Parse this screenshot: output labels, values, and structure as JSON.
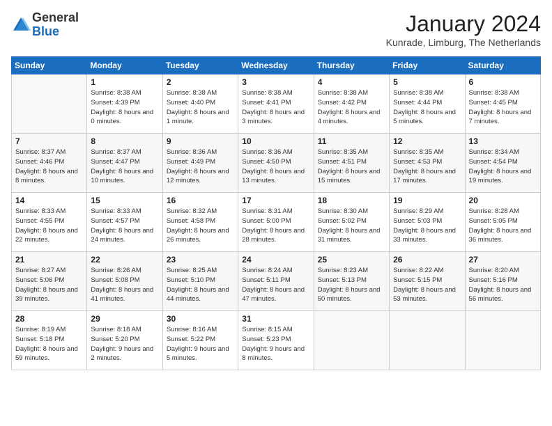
{
  "header": {
    "logo_general": "General",
    "logo_blue": "Blue",
    "month_title": "January 2024",
    "location": "Kunrade, Limburg, The Netherlands"
  },
  "days_of_week": [
    "Sunday",
    "Monday",
    "Tuesday",
    "Wednesday",
    "Thursday",
    "Friday",
    "Saturday"
  ],
  "weeks": [
    [
      {
        "day": "",
        "empty": true
      },
      {
        "day": "1",
        "sunrise": "Sunrise: 8:38 AM",
        "sunset": "Sunset: 4:39 PM",
        "daylight": "Daylight: 8 hours and 0 minutes."
      },
      {
        "day": "2",
        "sunrise": "Sunrise: 8:38 AM",
        "sunset": "Sunset: 4:40 PM",
        "daylight": "Daylight: 8 hours and 1 minute."
      },
      {
        "day": "3",
        "sunrise": "Sunrise: 8:38 AM",
        "sunset": "Sunset: 4:41 PM",
        "daylight": "Daylight: 8 hours and 3 minutes."
      },
      {
        "day": "4",
        "sunrise": "Sunrise: 8:38 AM",
        "sunset": "Sunset: 4:42 PM",
        "daylight": "Daylight: 8 hours and 4 minutes."
      },
      {
        "day": "5",
        "sunrise": "Sunrise: 8:38 AM",
        "sunset": "Sunset: 4:44 PM",
        "daylight": "Daylight: 8 hours and 5 minutes."
      },
      {
        "day": "6",
        "sunrise": "Sunrise: 8:38 AM",
        "sunset": "Sunset: 4:45 PM",
        "daylight": "Daylight: 8 hours and 7 minutes."
      }
    ],
    [
      {
        "day": "7",
        "sunrise": "Sunrise: 8:37 AM",
        "sunset": "Sunset: 4:46 PM",
        "daylight": "Daylight: 8 hours and 8 minutes."
      },
      {
        "day": "8",
        "sunrise": "Sunrise: 8:37 AM",
        "sunset": "Sunset: 4:47 PM",
        "daylight": "Daylight: 8 hours and 10 minutes."
      },
      {
        "day": "9",
        "sunrise": "Sunrise: 8:36 AM",
        "sunset": "Sunset: 4:49 PM",
        "daylight": "Daylight: 8 hours and 12 minutes."
      },
      {
        "day": "10",
        "sunrise": "Sunrise: 8:36 AM",
        "sunset": "Sunset: 4:50 PM",
        "daylight": "Daylight: 8 hours and 13 minutes."
      },
      {
        "day": "11",
        "sunrise": "Sunrise: 8:35 AM",
        "sunset": "Sunset: 4:51 PM",
        "daylight": "Daylight: 8 hours and 15 minutes."
      },
      {
        "day": "12",
        "sunrise": "Sunrise: 8:35 AM",
        "sunset": "Sunset: 4:53 PM",
        "daylight": "Daylight: 8 hours and 17 minutes."
      },
      {
        "day": "13",
        "sunrise": "Sunrise: 8:34 AM",
        "sunset": "Sunset: 4:54 PM",
        "daylight": "Daylight: 8 hours and 19 minutes."
      }
    ],
    [
      {
        "day": "14",
        "sunrise": "Sunrise: 8:33 AM",
        "sunset": "Sunset: 4:55 PM",
        "daylight": "Daylight: 8 hours and 22 minutes."
      },
      {
        "day": "15",
        "sunrise": "Sunrise: 8:33 AM",
        "sunset": "Sunset: 4:57 PM",
        "daylight": "Daylight: 8 hours and 24 minutes."
      },
      {
        "day": "16",
        "sunrise": "Sunrise: 8:32 AM",
        "sunset": "Sunset: 4:58 PM",
        "daylight": "Daylight: 8 hours and 26 minutes."
      },
      {
        "day": "17",
        "sunrise": "Sunrise: 8:31 AM",
        "sunset": "Sunset: 5:00 PM",
        "daylight": "Daylight: 8 hours and 28 minutes."
      },
      {
        "day": "18",
        "sunrise": "Sunrise: 8:30 AM",
        "sunset": "Sunset: 5:02 PM",
        "daylight": "Daylight: 8 hours and 31 minutes."
      },
      {
        "day": "19",
        "sunrise": "Sunrise: 8:29 AM",
        "sunset": "Sunset: 5:03 PM",
        "daylight": "Daylight: 8 hours and 33 minutes."
      },
      {
        "day": "20",
        "sunrise": "Sunrise: 8:28 AM",
        "sunset": "Sunset: 5:05 PM",
        "daylight": "Daylight: 8 hours and 36 minutes."
      }
    ],
    [
      {
        "day": "21",
        "sunrise": "Sunrise: 8:27 AM",
        "sunset": "Sunset: 5:06 PM",
        "daylight": "Daylight: 8 hours and 39 minutes."
      },
      {
        "day": "22",
        "sunrise": "Sunrise: 8:26 AM",
        "sunset": "Sunset: 5:08 PM",
        "daylight": "Daylight: 8 hours and 41 minutes."
      },
      {
        "day": "23",
        "sunrise": "Sunrise: 8:25 AM",
        "sunset": "Sunset: 5:10 PM",
        "daylight": "Daylight: 8 hours and 44 minutes."
      },
      {
        "day": "24",
        "sunrise": "Sunrise: 8:24 AM",
        "sunset": "Sunset: 5:11 PM",
        "daylight": "Daylight: 8 hours and 47 minutes."
      },
      {
        "day": "25",
        "sunrise": "Sunrise: 8:23 AM",
        "sunset": "Sunset: 5:13 PM",
        "daylight": "Daylight: 8 hours and 50 minutes."
      },
      {
        "day": "26",
        "sunrise": "Sunrise: 8:22 AM",
        "sunset": "Sunset: 5:15 PM",
        "daylight": "Daylight: 8 hours and 53 minutes."
      },
      {
        "day": "27",
        "sunrise": "Sunrise: 8:20 AM",
        "sunset": "Sunset: 5:16 PM",
        "daylight": "Daylight: 8 hours and 56 minutes."
      }
    ],
    [
      {
        "day": "28",
        "sunrise": "Sunrise: 8:19 AM",
        "sunset": "Sunset: 5:18 PM",
        "daylight": "Daylight: 8 hours and 59 minutes."
      },
      {
        "day": "29",
        "sunrise": "Sunrise: 8:18 AM",
        "sunset": "Sunset: 5:20 PM",
        "daylight": "Daylight: 9 hours and 2 minutes."
      },
      {
        "day": "30",
        "sunrise": "Sunrise: 8:16 AM",
        "sunset": "Sunset: 5:22 PM",
        "daylight": "Daylight: 9 hours and 5 minutes."
      },
      {
        "day": "31",
        "sunrise": "Sunrise: 8:15 AM",
        "sunset": "Sunset: 5:23 PM",
        "daylight": "Daylight: 9 hours and 8 minutes."
      },
      {
        "day": "",
        "empty": true
      },
      {
        "day": "",
        "empty": true
      },
      {
        "day": "",
        "empty": true
      }
    ]
  ]
}
